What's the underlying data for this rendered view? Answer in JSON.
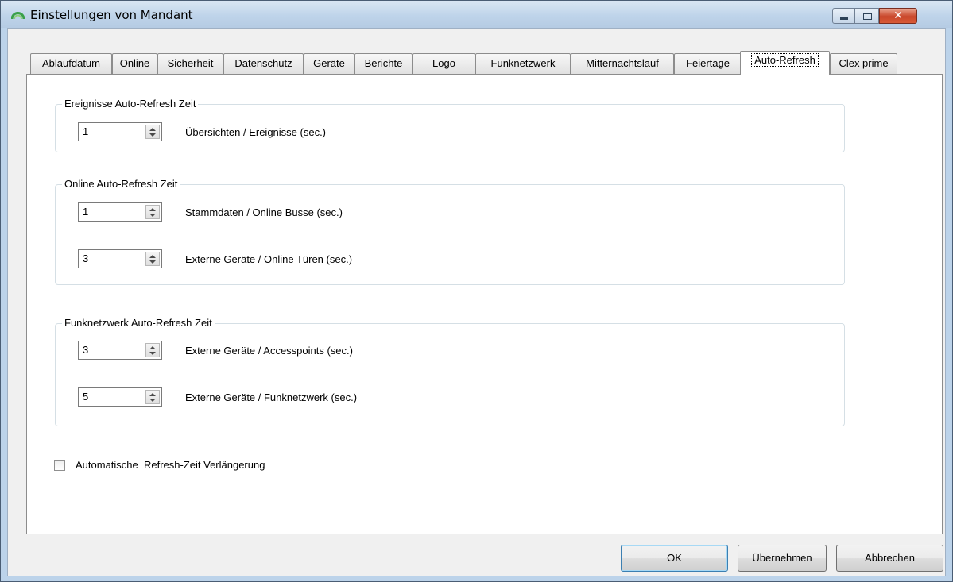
{
  "window": {
    "title": "Einstellungen von Mandant",
    "close_glyph": "✕"
  },
  "tabs": [
    {
      "label": "Ablaufdatum"
    },
    {
      "label": "Online"
    },
    {
      "label": "Sicherheit"
    },
    {
      "label": "Datenschutz"
    },
    {
      "label": "Geräte"
    },
    {
      "label": "Berichte"
    },
    {
      "label": "Logo"
    },
    {
      "label": "Funknetzwerk"
    },
    {
      "label": "Mitternachtslauf"
    },
    {
      "label": "Feiertage"
    },
    {
      "label": "Auto-Refresh",
      "active": true
    },
    {
      "label": "Clex prime"
    }
  ],
  "groups": {
    "ereignisse": {
      "title": "Ereignisse Auto-Refresh Zeit",
      "rows": [
        {
          "value": "1",
          "label": "Übersichten / Ereignisse (sec.)"
        }
      ]
    },
    "online": {
      "title": "Online Auto-Refresh Zeit",
      "rows": [
        {
          "value": "1",
          "label": "Stammdaten / Online Busse (sec.)"
        },
        {
          "value": "3",
          "label": "Externe Geräte / Online Türen (sec.)"
        }
      ]
    },
    "funk": {
      "title": "Funknetzwerk Auto-Refresh Zeit",
      "rows": [
        {
          "value": "3",
          "label": "Externe Geräte / Accesspoints (sec.)"
        },
        {
          "value": "5",
          "label": "Externe Geräte / Funknetzwerk (sec.)"
        }
      ]
    }
  },
  "auto_extension": {
    "label": "Automatische  Refresh-Zeit Verlängerung",
    "checked": false
  },
  "buttons": {
    "ok": "OK",
    "apply": "Übernehmen",
    "cancel": "Abbrechen"
  },
  "colors": {
    "title_bar": "#bfd4ea",
    "close_button": "#c9472b",
    "default_button_border": "#3c7fb1"
  },
  "icons": {
    "app": "app-logo-icon",
    "minimize": "minimize-icon",
    "maximize": "maximize-icon",
    "close": "close-icon",
    "spin_up": "spin-up-icon",
    "spin_down": "spin-down-icon"
  }
}
